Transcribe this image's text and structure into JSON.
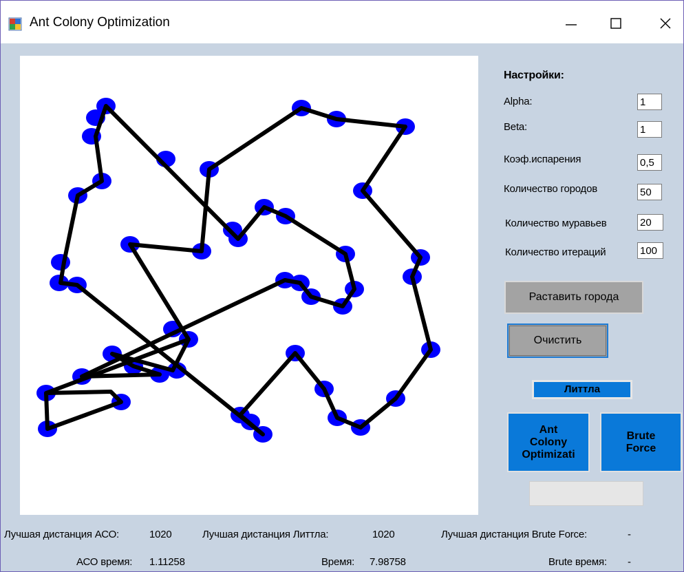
{
  "window": {
    "title": "Ant Colony Optimization",
    "controls": {
      "minimize": "—",
      "maximize": "☐",
      "close": "✕"
    }
  },
  "settings": {
    "header": "Настройки:",
    "fields": [
      {
        "label": "Alpha:",
        "value": "1"
      },
      {
        "label": "Beta:",
        "value": "1"
      },
      {
        "label": "Коэф.испарения",
        "value": "0,5"
      },
      {
        "label": "Количество городов",
        "value": "50"
      },
      {
        "label": "Количество муравьев",
        "value": "20"
      },
      {
        "label": "Количество итераций",
        "value": "100"
      }
    ]
  },
  "buttons": {
    "place_cities": "Раставить города",
    "clear": "Очистить",
    "littla": "Литтла",
    "aco_line1": "Ant",
    "aco_line2": "Colony",
    "aco_line3": "Optimizati",
    "brute_line1": "Brute",
    "brute_line2": "Force"
  },
  "progress": {
    "value": 0
  },
  "stats": {
    "best_aco_label": "Лучшая дистанция АСО:",
    "best_aco_value": "1020",
    "best_littla_label": "Лучшая дистанция  Литтла:",
    "best_littla_value": "1020",
    "best_brute_label": "Лучшая дистанция Brute Force:",
    "best_brute_value": "-",
    "aco_time_label": "АСО время:",
    "aco_time_value": "1.11258",
    "time_label": "Время:",
    "time_value": "7.98758",
    "brute_time_label": "Brute время:",
    "brute_time_value": "-"
  },
  "colors": {
    "city": "#0000ff",
    "route": "#000000",
    "accent_button": "#0a79d9",
    "form_background": "#c8d4e2"
  },
  "icons": {
    "app": "app-window-icon",
    "minimize": "minimize-icon",
    "maximize": "maximize-icon",
    "close": "close-icon"
  }
}
